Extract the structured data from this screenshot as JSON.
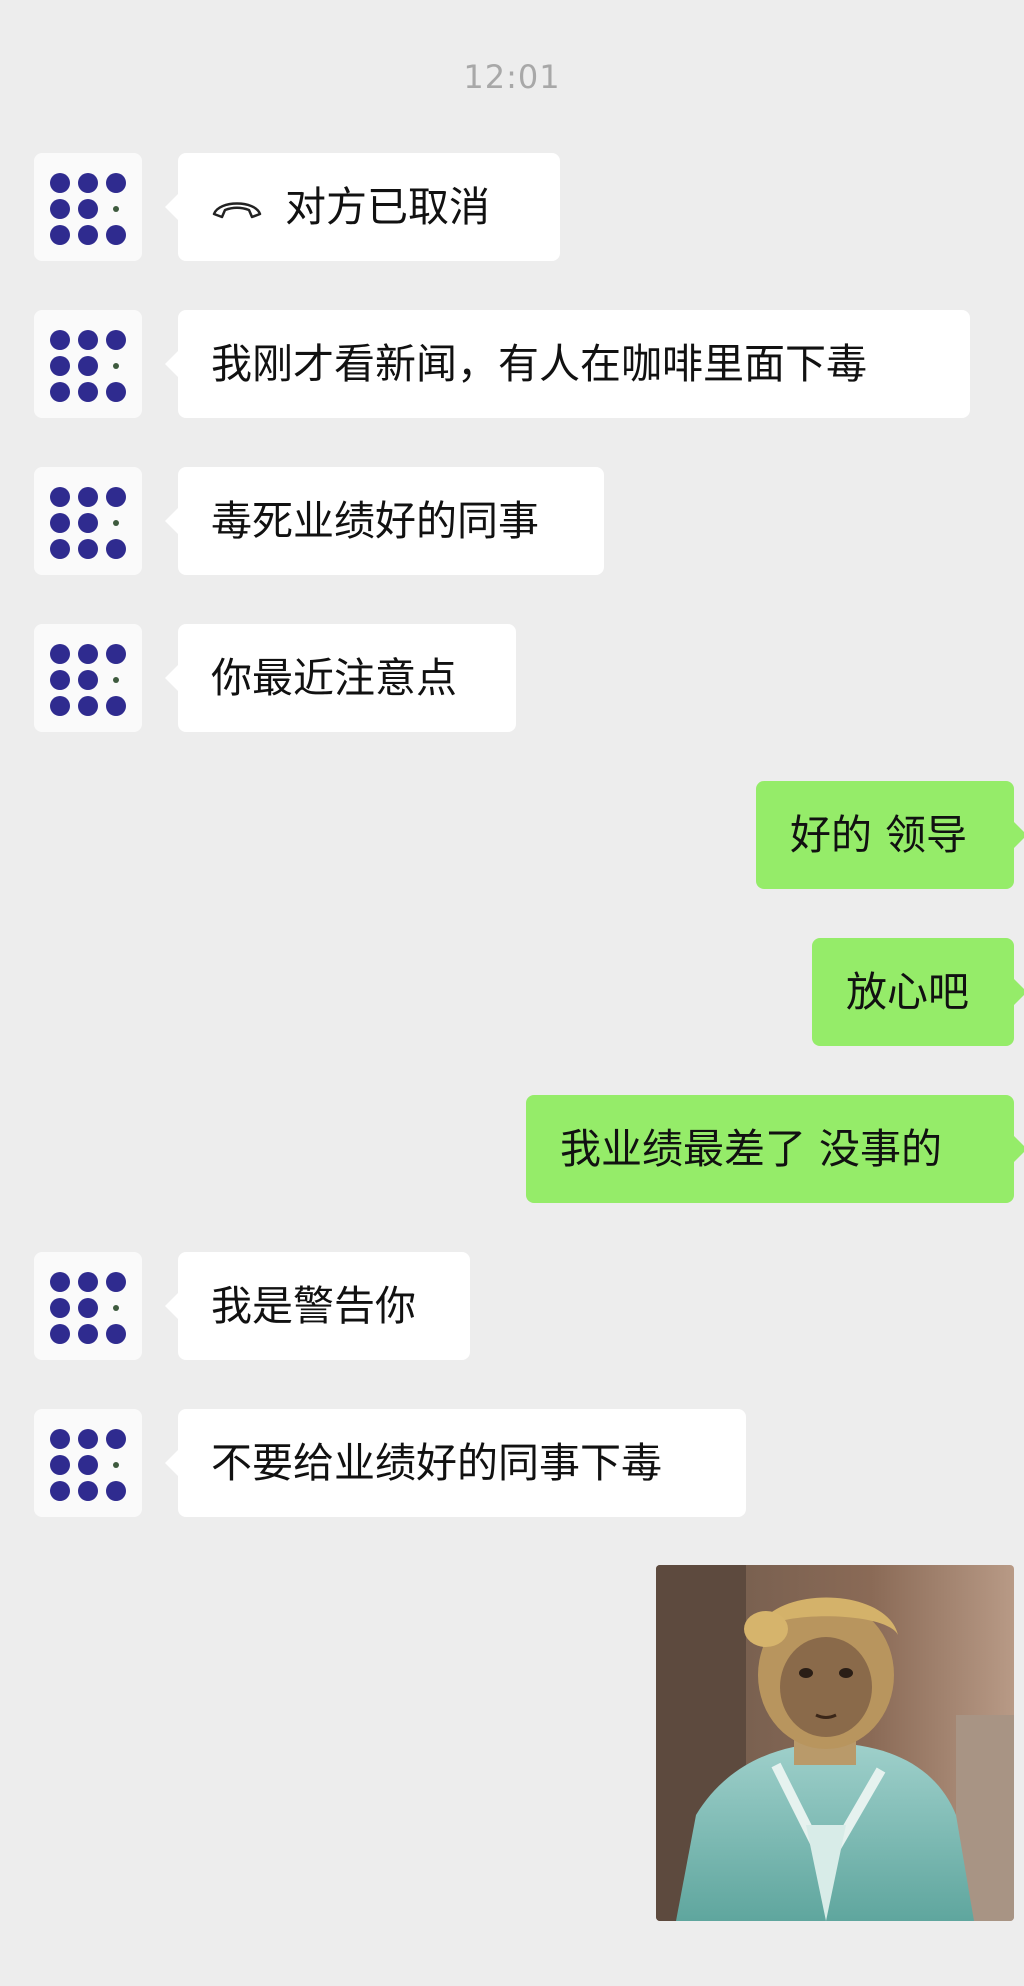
{
  "chat": {
    "timestamp": "12:01",
    "messages": [
      {
        "side": "left",
        "text": "对方已取消",
        "icon": "phone-hangup-icon"
      },
      {
        "side": "left",
        "text": "我刚才看新闻，有人在咖啡里面下毒"
      },
      {
        "side": "left",
        "text": "毒死业绩好的同事"
      },
      {
        "side": "left",
        "text": "你最近注意点"
      },
      {
        "side": "right",
        "text": "好的 领导"
      },
      {
        "side": "right",
        "text": "放心吧"
      },
      {
        "side": "right",
        "text": "我业绩最差了 没事的"
      },
      {
        "side": "left",
        "text": "我是警告你"
      },
      {
        "side": "left",
        "text": "不要给业绩好的同事下毒"
      },
      {
        "side": "right",
        "type": "image",
        "image": "meme-photo-monkey-king"
      }
    ]
  },
  "colors": {
    "background": "#ededed",
    "incoming_bubble": "#ffffff",
    "outgoing_bubble": "#95ec69",
    "avatar_dots": "#2f2b8f",
    "timestamp": "#a8a8a8"
  }
}
